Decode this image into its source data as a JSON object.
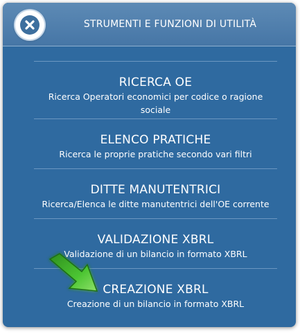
{
  "header": {
    "title": "STRUMENTI E FUNZIONI DI UTILITÀ",
    "close_icon": "close-icon"
  },
  "menu": {
    "items": [
      {
        "title": "RICERCA OE",
        "description": "Ricerca Operatori economici per codice o ragione sociale"
      },
      {
        "title": "ELENCO PRATICHE",
        "description": "Ricerca le proprie pratiche secondo vari filtri"
      },
      {
        "title": "DITTE MANUTENTRICI",
        "description": "Ricerca/Elenca le ditte manutentrici dell'OE corrente"
      },
      {
        "title": "VALIDAZIONE XBRL",
        "description": "Validazione di un bilancio in formato XBRL"
      },
      {
        "title": "CREAZIONE XBRL",
        "description": "Creazione di un bilancio in formato XBRL"
      }
    ]
  },
  "pointer": {
    "icon": "green-arrow-icon",
    "color": "#3fb82a"
  },
  "colors": {
    "panel": "#2f6aa0",
    "header": "#4676a6",
    "divider": "#6c97c1"
  }
}
